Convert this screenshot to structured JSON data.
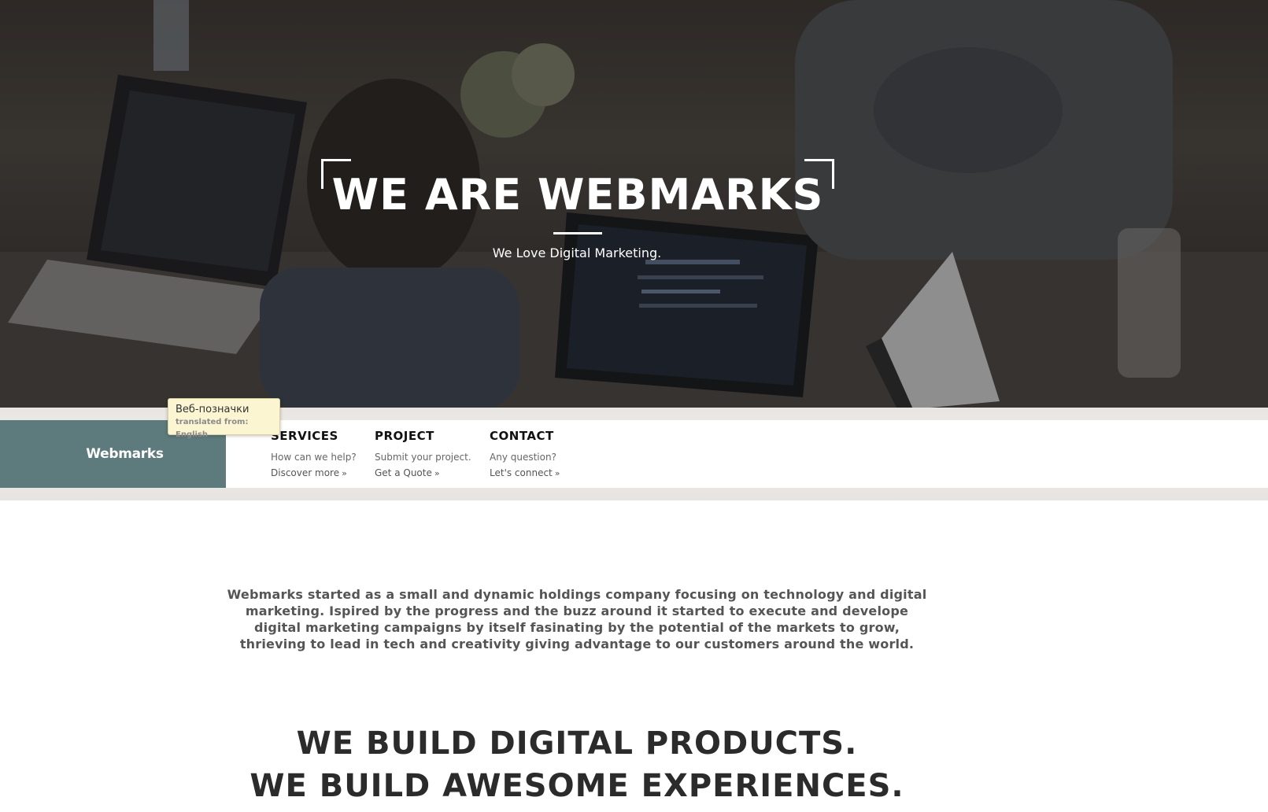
{
  "hero": {
    "title": "WE ARE WEBMARKS",
    "subtitle": "We Love Digital Marketing."
  },
  "nav": {
    "brand": "Webmarks",
    "columns": [
      {
        "title": "SERVICES",
        "text": "How can we help?",
        "link": "Discover more"
      },
      {
        "title": "PROJECT",
        "text": "Submit your project.",
        "link": "Get a Quote"
      },
      {
        "title": "CONTACT",
        "text": "Any question?",
        "link": "Let's connect"
      }
    ],
    "link_icon": "double-chevron-right-icon"
  },
  "tooltip": {
    "translation": "Веб-позначки",
    "source": "translated from: English"
  },
  "intro": {
    "text": "Webmarks started as a small and dynamic holdings company focusing on technology and digital marketing. Ispired by the progress and the buzz around it started to execute and develope digital marketing campaigns by itself fasinating by the potential of the markets to grow, thrieving to lead in tech and creativity giving advantage to our customers around the world."
  },
  "headline": {
    "line1": "WE BUILD DIGITAL PRODUCTS.",
    "line2": "WE BUILD AWESOME EXPERIENCES."
  },
  "colors": {
    "brand_panel": "#5d7a7d",
    "headline_text": "#2b2b2b",
    "tooltip_bg": "#fbf5d2"
  }
}
